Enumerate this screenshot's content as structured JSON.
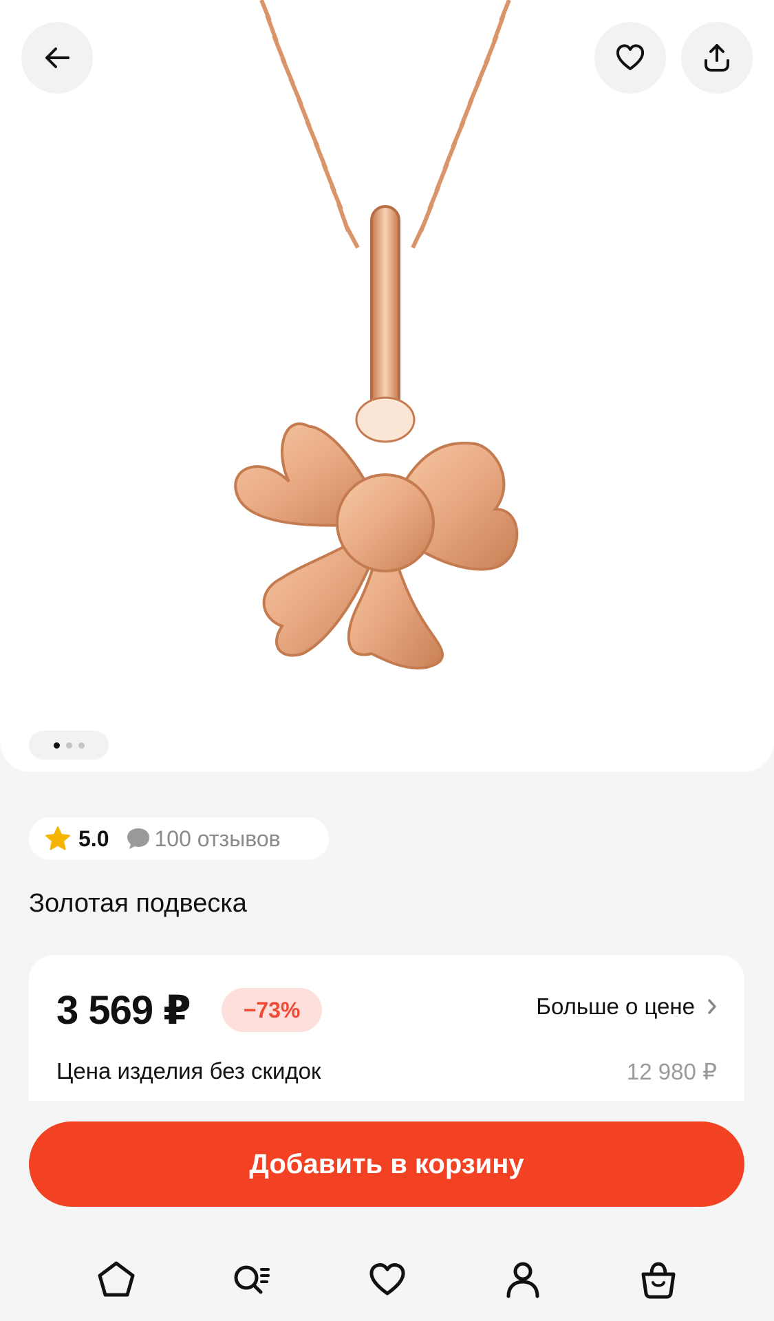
{
  "gallery": {
    "image_subject": "gold-clover-pendant",
    "slide_count": 3,
    "active_slide": 1
  },
  "header": {
    "back_icon": "arrow-left-icon",
    "favorite_icon": "heart-icon",
    "share_icon": "share-icon"
  },
  "rating": {
    "value": "5.0",
    "reviews": "100 отзывов"
  },
  "product": {
    "title": "Золотая подвеска"
  },
  "price": {
    "current": "3 569 ₽",
    "discount": "−73%",
    "more_label": "Больше о цене",
    "base_label": "Цена изделия без скидок",
    "base_value": "12 980 ₽"
  },
  "cart": {
    "button_label": "Добавить в корзину"
  },
  "tabbar": {
    "items": [
      "home-icon",
      "catalog-search-icon",
      "favorites-icon",
      "profile-icon",
      "cart-bag-icon"
    ]
  },
  "colors": {
    "accent": "#f24123",
    "discount_bg": "#fde0dc",
    "discount_text": "#f04a37",
    "gold": "#e8a982",
    "star": "#f5b400"
  }
}
